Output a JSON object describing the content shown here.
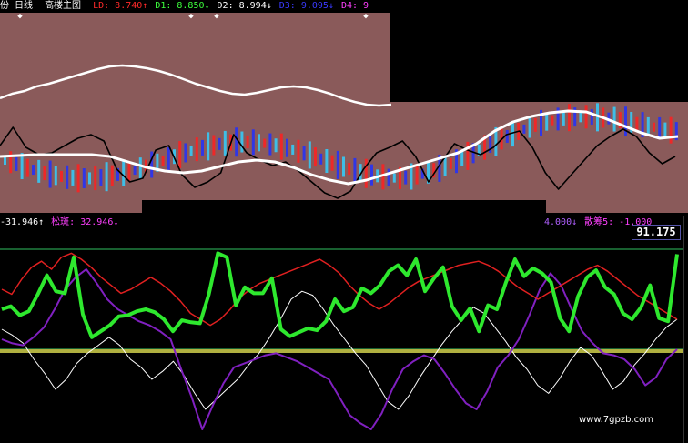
{
  "chart_data": [
    {
      "type": "line",
      "panel": "main",
      "title": "高楼主图",
      "period": "日线",
      "header_items": [
        {
          "label": "LD:",
          "value": "8.740",
          "arrow": "↑",
          "color": "#ff2a2a"
        },
        {
          "label": "D1:",
          "value": "8.850",
          "arrow": "↓",
          "color": "#3cff3c"
        },
        {
          "label": "D2:",
          "value": "8.994",
          "arrow": "↓",
          "color": "#ffffff"
        },
        {
          "label": "D3:",
          "value": "9.095",
          "arrow": "↓",
          "color": "#3a3aff"
        },
        {
          "label": "D4:",
          "value": "9",
          "arrow": "",
          "color": "#ff40ff"
        }
      ],
      "background": "#8a5a5a",
      "series": [
        {
          "color": "#ffffff",
          "y": [
            108,
            103,
            100,
            95,
            92,
            88,
            84,
            80,
            76,
            73,
            72,
            73,
            75,
            78,
            82,
            87,
            92,
            96,
            100,
            103,
            104,
            102,
            99,
            96,
            95,
            96,
            99,
            103,
            108,
            112,
            115,
            116,
            115
          ]
        },
        {
          "color": "#ffffff",
          "y": [
            172,
            171,
            170,
            170,
            170,
            170,
            172,
            178,
            184,
            188,
            190,
            188,
            183,
            178,
            176,
            178,
            184,
            192,
            198,
            202,
            198,
            192,
            186,
            180,
            174,
            168,
            158,
            144,
            134,
            128,
            124,
            122,
            123,
            130,
            138,
            146,
            152,
            150
          ]
        },
        {
          "color": "#000000",
          "y": [
            160,
            140,
            162,
            170,
            168,
            160,
            152,
            148,
            155,
            186,
            200,
            196,
            165,
            160,
            192,
            206,
            200,
            190,
            148,
            168,
            176,
            182,
            178,
            188,
            200,
            212,
            218,
            210,
            186,
            168,
            162,
            155,
            172,
            200,
            178,
            158,
            165,
            170,
            162,
            148,
            144,
            162,
            190,
            208,
            192,
            176,
            160,
            150,
            142,
            150,
            168,
            180,
            172
          ]
        }
      ]
    },
    {
      "type": "line",
      "panel": "indicator",
      "header_items": [
        {
          "label": "",
          "value": "-31.946",
          "arrow": "↑",
          "color": "#ffffff"
        },
        {
          "label": "松斑:",
          "value": "32.946",
          "arrow": "↓",
          "color": "#ff40ff"
        }
      ],
      "header_items_right": [
        {
          "label": "",
          "value": "4.000",
          "arrow": "↓",
          "color": "#b060ff"
        },
        {
          "label": "散筹5:",
          "value": "-1.000",
          "arrow": "",
          "color": "#ff40ff"
        }
      ],
      "value_box": "91.175",
      "reference_levels": [
        100,
        0
      ],
      "series": [
        {
          "name": "",
          "color": "#2ee82e",
          "y": [
            40,
            43,
            34,
            38,
            55,
            74,
            58,
            56,
            92,
            35,
            12,
            18,
            24,
            33,
            34,
            38,
            40,
            37,
            30,
            18,
            29,
            27,
            26,
            55,
            96,
            92,
            44,
            62,
            56,
            56,
            71,
            20,
            13,
            17,
            21,
            19,
            28,
            50,
            38,
            42,
            61,
            56,
            64,
            78,
            84,
            74,
            90,
            58,
            71,
            82,
            43,
            29,
            41,
            18,
            44,
            40,
            67,
            90,
            73,
            81,
            76,
            67,
            31,
            18,
            53,
            72,
            79,
            62,
            55,
            36,
            30,
            42,
            64,
            31,
            28,
            95
          ]
        },
        {
          "name": "",
          "color": "#e02020",
          "y": [
            60,
            55,
            70,
            82,
            88,
            80,
            92,
            96,
            90,
            82,
            72,
            64,
            56,
            60,
            66,
            72,
            66,
            58,
            48,
            36,
            30,
            24,
            30,
            40,
            52,
            60,
            66,
            70,
            74,
            78,
            82,
            86,
            90,
            84,
            76,
            64,
            54,
            46,
            40,
            46,
            54,
            62,
            68,
            72,
            76,
            80,
            84,
            86,
            88,
            84,
            78,
            70,
            62,
            56,
            50,
            56,
            62,
            68,
            74,
            80,
            84,
            78,
            70,
            62,
            54,
            48,
            42,
            36,
            30
          ]
        },
        {
          "name": "",
          "color": "#8020c0",
          "y": [
            10,
            6,
            4,
            12,
            22,
            40,
            60,
            72,
            80,
            66,
            50,
            40,
            34,
            28,
            24,
            18,
            10,
            -20,
            -48,
            -80,
            -56,
            -34,
            -18,
            -14,
            -10,
            -6,
            -4,
            -8,
            -12,
            -18,
            -24,
            -30,
            -48,
            -66,
            -74,
            -80,
            -64,
            -40,
            -20,
            -12,
            -6,
            -10,
            -24,
            -40,
            -54,
            -60,
            -42,
            -18,
            -6,
            10,
            34,
            60,
            76,
            64,
            40,
            18,
            6,
            -4,
            -6,
            -10,
            -20,
            -36,
            -28,
            -10,
            0
          ]
        },
        {
          "name": "",
          "color": "#ffffff",
          "y": [
            20,
            14,
            6,
            -10,
            -24,
            -40,
            -30,
            -14,
            -4,
            4,
            12,
            4,
            -10,
            -18,
            -30,
            -22,
            -12,
            -26,
            -44,
            -60,
            -50,
            -40,
            -30,
            -16,
            -4,
            12,
            30,
            50,
            58,
            54,
            40,
            24,
            10,
            -4,
            -16,
            -34,
            -52,
            -60,
            -46,
            -28,
            -12,
            4,
            18,
            30,
            42,
            36,
            22,
            8,
            -8,
            -20,
            -36,
            -44,
            -30,
            -12,
            2,
            -6,
            -22,
            -40,
            -32,
            -16,
            -4,
            10,
            22,
            30
          ]
        }
      ]
    }
  ],
  "watermark": "www.7gpzb.com",
  "top_markers": [
    "◆",
    "◆",
    "◆",
    "◆"
  ],
  "header_lead": "份 日线"
}
